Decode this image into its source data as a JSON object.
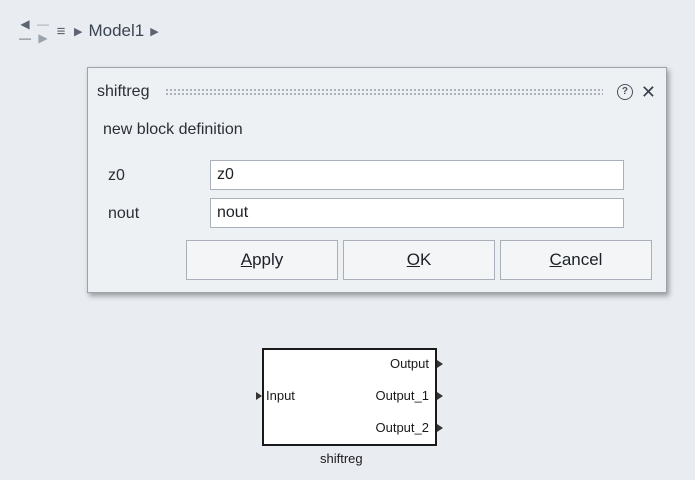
{
  "breadcrumb": {
    "back_icon": "arrow-left-icon",
    "forward_icon": "arrow-right-icon",
    "list_icon": "list-icon",
    "model_name": "Model1"
  },
  "dialog": {
    "title": "shiftreg",
    "subtitle": "new block definition",
    "fields": [
      {
        "label": "z0",
        "value": "z0"
      },
      {
        "label": "nout",
        "value": "nout"
      }
    ],
    "buttons": {
      "apply": {
        "mnemonic": "A",
        "rest": "pply"
      },
      "ok": {
        "mnemonic": "O",
        "rest": "K"
      },
      "cancel": {
        "mnemonic": "C",
        "rest": "ancel"
      }
    }
  },
  "block": {
    "name": "shiftreg",
    "inputs": [
      "Input"
    ],
    "outputs": [
      "Output",
      "Output_1",
      "Output_2"
    ]
  }
}
